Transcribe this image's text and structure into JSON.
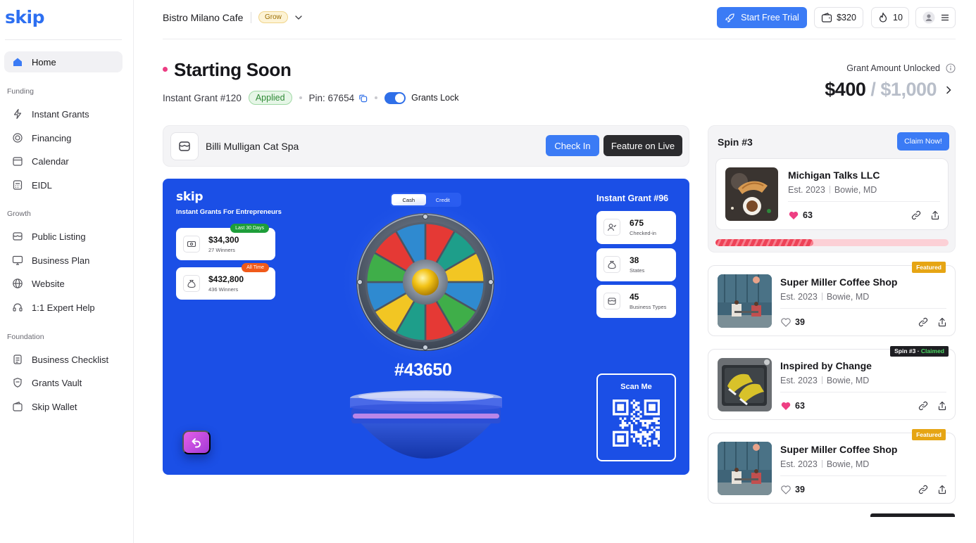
{
  "brand": {
    "logo": "skip",
    "accent": "#3b7bf5",
    "panel_blue": "#1b4fe6"
  },
  "sidebar": {
    "home": "Home",
    "sections": {
      "funding": "Funding",
      "growth": "Growth",
      "foundation": "Foundation"
    },
    "funding_items": [
      {
        "label": "Instant Grants",
        "icon": "bolt-icon"
      },
      {
        "label": "Financing",
        "icon": "coin-icon"
      },
      {
        "label": "Calendar",
        "icon": "calendar-icon"
      },
      {
        "label": "EIDL",
        "icon": "calculator-icon"
      }
    ],
    "growth_items": [
      {
        "label": "Public Listing",
        "icon": "storefront-icon"
      },
      {
        "label": "Business Plan",
        "icon": "monitor-icon"
      },
      {
        "label": "Website",
        "icon": "globe-icon"
      },
      {
        "label": "1:1 Expert Help",
        "icon": "headset-icon"
      }
    ],
    "foundation_items": [
      {
        "label": "Business Checklist",
        "icon": "checklist-icon"
      },
      {
        "label": "Grants Vault",
        "icon": "shield-icon"
      },
      {
        "label": "Skip Wallet",
        "icon": "wallet-icon"
      }
    ]
  },
  "topbar": {
    "business_name": "Bistro Milano Cafe",
    "plan_badge": "Grow",
    "trial_button": "Start Free Trial",
    "wallet_amount": "$320",
    "streak_count": "10"
  },
  "header": {
    "title": "Starting Soon",
    "grant_label": "Instant Grant #120",
    "status_badge": "Applied",
    "pin": "Pin: 67654",
    "toggle_label": "Grants Lock",
    "toggle_on": true,
    "unlock_label": "Grant Amount Unlocked",
    "unlocked_amount": "$400",
    "separator": "/",
    "total_amount": "$1,000"
  },
  "business_row": {
    "name": "Billi Mulligan Cat Spa",
    "checkin_button": "Check In",
    "feature_button": "Feature on Live"
  },
  "live_panel": {
    "logo": "skip",
    "tagline": "Instant Grants For Entrepreneurs",
    "segment": {
      "options": [
        "Cash",
        "Credit"
      ],
      "selected": "Cash"
    },
    "left_stats": [
      {
        "value": "$34,300",
        "label": "27 Winners",
        "tag": "Last 30 Days",
        "icon": "cash-icon"
      },
      {
        "value": "$432,800",
        "label": "436 Winners",
        "tag": "All Time",
        "icon": "money-bag-icon"
      }
    ],
    "right_title": "Instant Grant #96",
    "right_stats": [
      {
        "value": "675",
        "label": "Checked-in",
        "icon": "user-check-icon"
      },
      {
        "value": "38",
        "label": "States",
        "icon": "money-bag-icon"
      },
      {
        "value": "45",
        "label": "Business Types",
        "icon": "store-icon"
      }
    ],
    "spin_number": "#43650",
    "scan_label": "Scan Me",
    "wheel_colors": [
      "#e53935",
      "#1e9e8a",
      "#f2c623",
      "#2f8ad0",
      "#3fae49",
      "#e53935",
      "#1e9e8a",
      "#f2c623",
      "#2f8ad0",
      "#3fae49",
      "#e53935",
      "#2f8ad0"
    ]
  },
  "right_column": {
    "spin_label": "Spin #3",
    "claim_button": "Claim Now!",
    "spin_progress": 0.42,
    "cards": [
      {
        "name": "Michigan Talks LLC",
        "est": "Est. 2023",
        "location": "Bowie, MD",
        "likes": "63",
        "liked": true,
        "ribbon": "",
        "thumb": "coffee"
      },
      {
        "name": "Super Miller Coffee Shop",
        "est": "Est. 2023",
        "location": "Bowie, MD",
        "likes": "39",
        "liked": false,
        "ribbon": "Featured",
        "thumb": "office"
      },
      {
        "name": "Inspired by Change",
        "est": "Est. 2023",
        "location": "Bowie, MD",
        "likes": "63",
        "liked": true,
        "ribbon_spin": "Spin #3",
        "ribbon_claimed": "Claimed",
        "thumb": "shoes"
      },
      {
        "name": "Super Miller Coffee Shop",
        "est": "Est. 2023",
        "location": "Bowie, MD",
        "likes": "39",
        "liked": false,
        "ribbon": "Featured",
        "thumb": "office"
      }
    ]
  }
}
